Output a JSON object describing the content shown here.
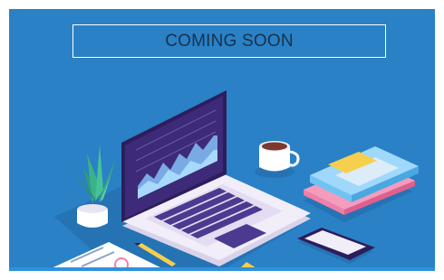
{
  "banner": {
    "headline": "COMING SOON"
  },
  "colors": {
    "background": "#2a81c5",
    "headline_text": "#17324d",
    "laptop_body": "#f2eef9",
    "laptop_screen": "#3d2a78",
    "keys": "#4b3a8f",
    "plant_leaf": "#3bb18a",
    "book_blue": "#6fc3f2",
    "book_pink": "#f07fa6",
    "sticky_note": "#f6cf4e"
  },
  "icons": {
    "laptop": "laptop-icon",
    "plant": "plant-icon",
    "mug": "coffee-mug-icon",
    "books": "books-icon",
    "phone": "smartphone-icon",
    "document": "document-icon",
    "pencil": "pencil-icon"
  }
}
